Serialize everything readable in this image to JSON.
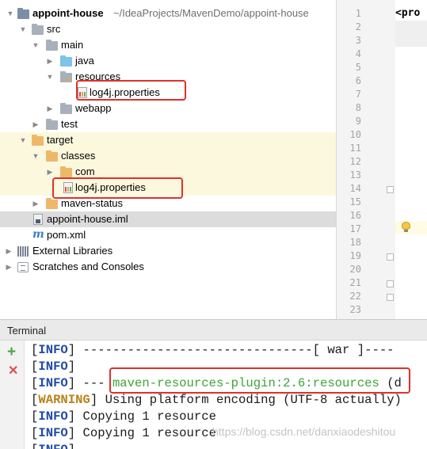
{
  "project_tree": {
    "root": {
      "label": "appoint-house",
      "path": "~/IdeaProjects/MavenDemo/appoint-house"
    },
    "items": [
      {
        "label": "src"
      },
      {
        "label": "main"
      },
      {
        "label": "java"
      },
      {
        "label": "resources"
      },
      {
        "label": "log4j.properties"
      },
      {
        "label": "webapp"
      },
      {
        "label": "test"
      },
      {
        "label": "target"
      },
      {
        "label": "classes"
      },
      {
        "label": "com"
      },
      {
        "label": "log4j.properties"
      },
      {
        "label": "maven-status"
      },
      {
        "label": "appoint-house.iml"
      },
      {
        "label": "pom.xml"
      },
      {
        "label": "External Libraries"
      },
      {
        "label": "Scratches and Consoles"
      }
    ]
  },
  "editor": {
    "line_numbers": [
      "1",
      "2",
      "3",
      "4",
      "5",
      "6",
      "7",
      "8",
      "9",
      "10",
      "11",
      "12",
      "13",
      "14",
      "15",
      "16",
      "17",
      "18",
      "19",
      "20",
      "21",
      "22",
      "23"
    ],
    "code_line_1": "<pro"
  },
  "terminal": {
    "title": "Terminal",
    "lines": [
      {
        "l": "[",
        "level": "INFO",
        "r": "] ",
        "text": "-------------------------------[ war ]----"
      },
      {
        "l": "[",
        "level": "INFO",
        "r": "]",
        "text": ""
      },
      {
        "l": "[",
        "level": "INFO",
        "r": "] ",
        "pre": "--- ",
        "plugin": "maven-resources-plugin:2.6:resources",
        "post": " (d"
      },
      {
        "l": "[",
        "level": "WARNING",
        "r": "] ",
        "text": "Using platform encoding (UTF-8 actually)"
      },
      {
        "l": "[",
        "level": "INFO",
        "r": "] ",
        "text": "Copying 1 resource"
      },
      {
        "l": "[",
        "level": "INFO",
        "r": "] ",
        "text": "Copying 1 resource"
      },
      {
        "l": "[",
        "level": "INFO",
        "r": "]",
        "text": ""
      }
    ],
    "watermark": "https://blog.csdn.net/danxiaodeshitou"
  },
  "colors": {
    "highlight_box": "#e0302a",
    "target_row": "#fcf8dd",
    "selected_row": "#dcdcdc",
    "info": "#1f4aa8",
    "warning": "#b8821b",
    "plugin": "#3ea33a"
  }
}
